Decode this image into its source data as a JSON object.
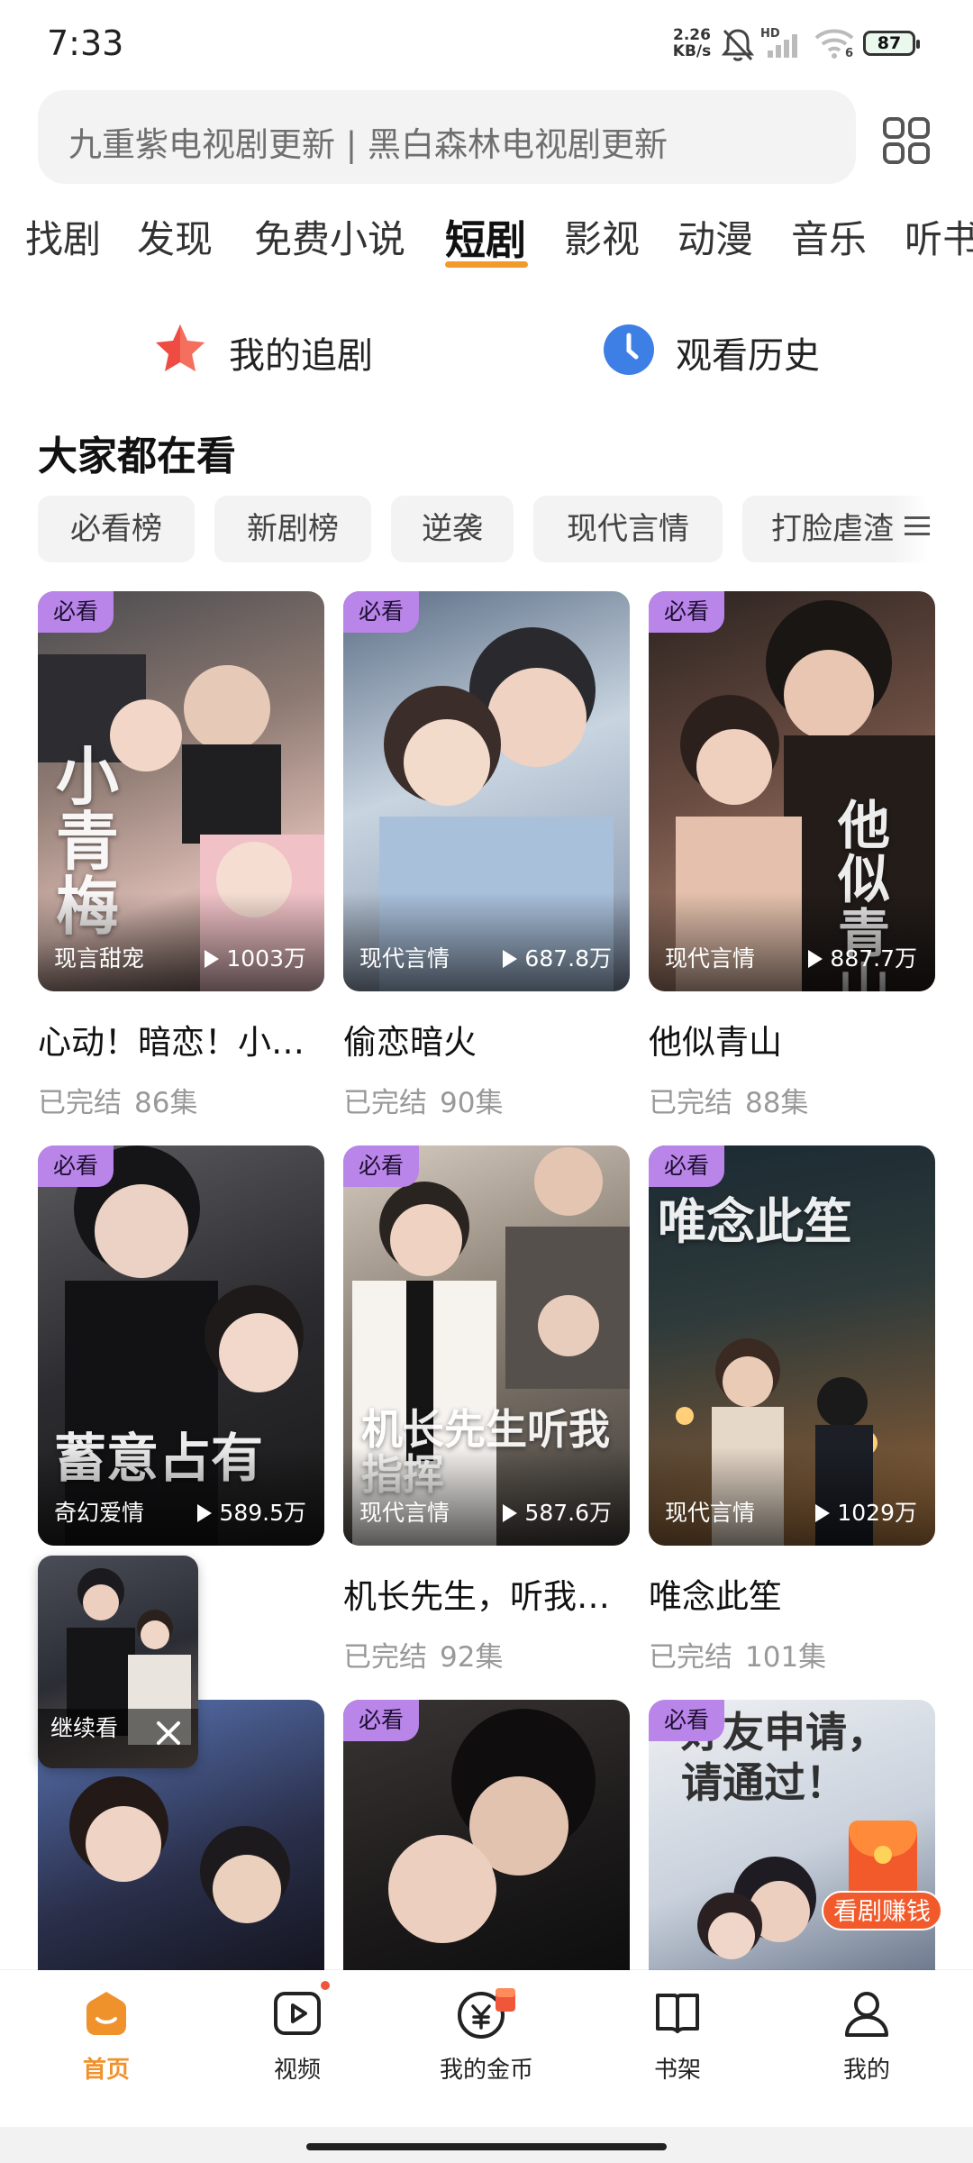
{
  "status_bar": {
    "time": "7:33",
    "net_speed_value": "2.26",
    "net_speed_unit": "KB/s",
    "signal_tag": "HD",
    "wifi_tag": "6",
    "battery": "87"
  },
  "search": {
    "placeholder": "九重紫电视剧更新 | 黑白森林电视剧更新"
  },
  "tabs": [
    {
      "label": "找剧"
    },
    {
      "label": "发现"
    },
    {
      "label": "免费小说"
    },
    {
      "label": "短剧"
    },
    {
      "label": "影视"
    },
    {
      "label": "动漫"
    },
    {
      "label": "音乐"
    },
    {
      "label": "听书"
    }
  ],
  "active_tab": "短剧",
  "quick_links": {
    "my_follow": "我的追剧",
    "history": "观看历史"
  },
  "section": {
    "title": "大家都在看",
    "chips": [
      "必看榜",
      "新剧榜",
      "逆袭",
      "现代言情",
      "打脸虐渣"
    ]
  },
  "cards": [
    {
      "badge": "必看",
      "genre": "现言甜宠",
      "plays": "1003万",
      "title": "心动！暗恋！小…",
      "status": "已完结",
      "episodes": "86集",
      "poster_text": "小青梅"
    },
    {
      "badge": "必看",
      "genre": "现代言情",
      "plays": "687.8万",
      "title": "偷恋暗火",
      "status": "已完结",
      "episodes": "90集",
      "poster_text": ""
    },
    {
      "badge": "必看",
      "genre": "现代言情",
      "plays": "887.7万",
      "title": "他似青山",
      "status": "已完结",
      "episodes": "88集",
      "poster_text": "他似青山"
    },
    {
      "badge": "必看",
      "genre": "奇幻爱情",
      "plays": "589.5万",
      "title": "",
      "status": "",
      "episodes": "",
      "poster_text": "蓄意占有"
    },
    {
      "badge": "必看",
      "genre": "现代言情",
      "plays": "587.6万",
      "title": "机长先生，听我…",
      "status": "已完结",
      "episodes": "92集",
      "poster_text": "机长先生听我指挥"
    },
    {
      "badge": "必看",
      "genre": "现代言情",
      "plays": "1029万",
      "title": "唯念此笙",
      "status": "已完结",
      "episodes": "101集",
      "poster_text": "唯念此笙"
    },
    {
      "badge": "",
      "genre": "",
      "plays": "",
      "title": "",
      "status": "",
      "episodes": "",
      "poster_text": ""
    },
    {
      "badge": "必看",
      "genre": "",
      "plays": "",
      "title": "",
      "status": "",
      "episodes": "",
      "poster_text": ""
    },
    {
      "badge": "必看",
      "genre": "",
      "plays": "",
      "title": "",
      "status": "",
      "episodes": "",
      "poster_text": "好友申请，请通过！"
    }
  ],
  "floating": {
    "continue_label": "继续看"
  },
  "earn": {
    "label": "看剧赚钱"
  },
  "bottom_nav": [
    {
      "label": "首页",
      "icon": "home-icon"
    },
    {
      "label": "视频",
      "icon": "video-icon"
    },
    {
      "label": "我的金币",
      "icon": "coin-icon"
    },
    {
      "label": "书架",
      "icon": "bookshelf-icon"
    },
    {
      "label": "我的",
      "icon": "profile-icon"
    }
  ],
  "colors": {
    "accent": "#f0922c",
    "badge": "#b985e8",
    "chip_bg": "#f3f3f3",
    "search_bg": "#f3f3f3"
  }
}
